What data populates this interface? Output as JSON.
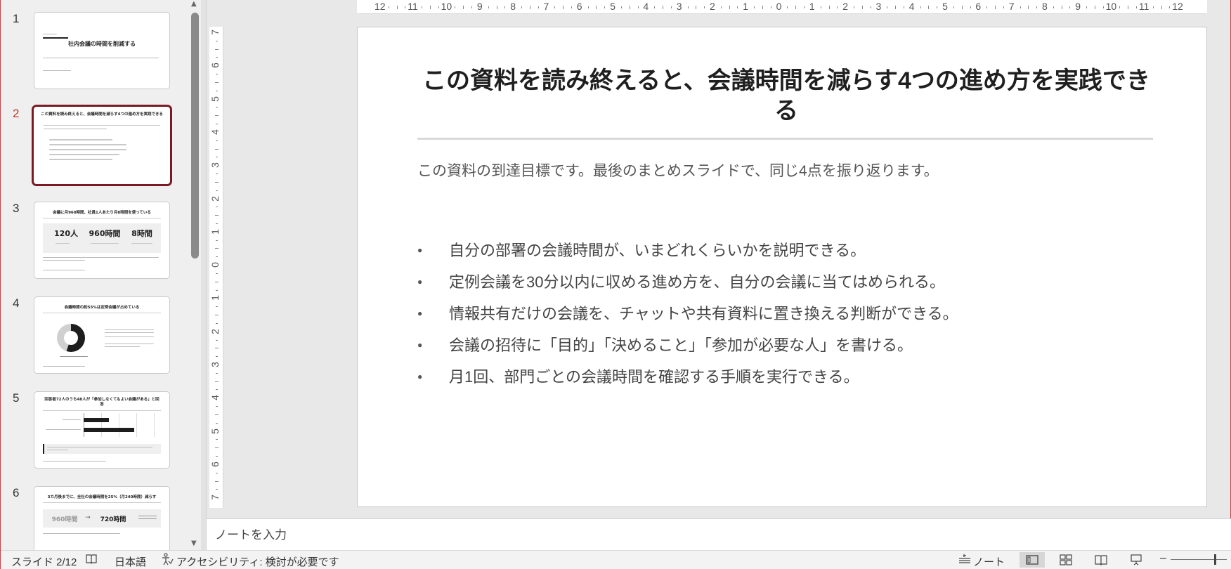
{
  "thumbnails": [
    {
      "num": "1",
      "title": "社内会議の時間を削減する"
    },
    {
      "num": "2",
      "title": "この資料を読み終えると、会議時間を減らす4つの進め方を実践できる"
    },
    {
      "num": "3",
      "title": "会議に月960時間、社員1人あたり月8時間を使っている",
      "stats": [
        "120人",
        "960時間",
        "8時間"
      ]
    },
    {
      "num": "4",
      "title": "会議時間の約55%は定例会議が占めている"
    },
    {
      "num": "5",
      "title": "回答者72人のうち48人が「参加しなくてもよい会議がある」と回答"
    },
    {
      "num": "6",
      "title": "3カ月後までに、全社の会議時間を25%（月240時間）減らす",
      "from": "960時間",
      "arrow": "→",
      "to": "720時間"
    }
  ],
  "ruler": {
    "h_labels": [
      "12",
      "11",
      "10",
      "9",
      "8",
      "7",
      "6",
      "5",
      "4",
      "3",
      "2",
      "1",
      "0",
      "1",
      "2",
      "3",
      "4",
      "5",
      "6",
      "7",
      "8",
      "9",
      "10",
      "11",
      "12"
    ],
    "v_labels": [
      "7",
      "6",
      "5",
      "4",
      "3",
      "2",
      "1",
      "0",
      "1",
      "2",
      "3",
      "4",
      "5",
      "6",
      "7"
    ]
  },
  "slide": {
    "title": "この資料を読み終えると、会議時間を減らす4つの進め方を実践できる",
    "lead": "この資料の到達目標です。最後のまとめスライドで、同じ4点を振り返ります。",
    "bullets": [
      "自分の部署の会議時間が、いまどれくらいかを説明できる。",
      "定例会議を30分以内に収める進め方を、自分の会議に当てはめられる。",
      "情報共有だけの会議を、チャットや共有資料に置き換える判断ができる。",
      "会議の招待に「目的」「決めること」「参加が必要な人」を書ける。",
      "月1回、部門ごとの会議時間を確認する手順を実行できる。"
    ]
  },
  "notes": {
    "placeholder": "ノートを入力"
  },
  "status": {
    "slide_indicator": "スライド 2/12",
    "language": "日本語",
    "accessibility": "アクセシビリティ: 検討が必要です",
    "notes_label": "ノート"
  },
  "colors": {
    "accent": "#c0392b",
    "active_border": "#7a1a24"
  }
}
